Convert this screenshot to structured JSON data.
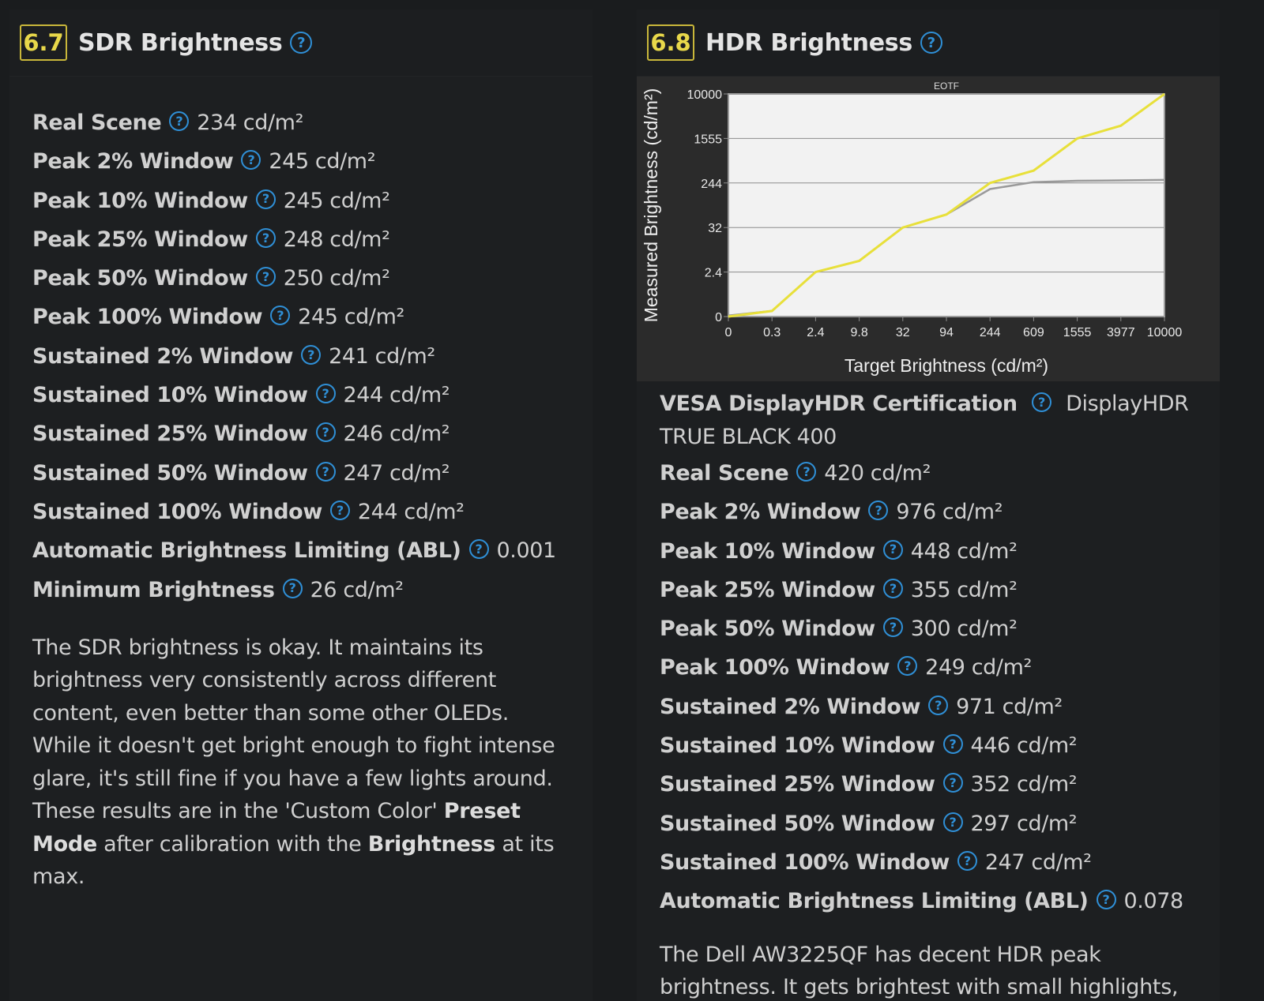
{
  "sdr": {
    "score": "6.7",
    "title": "SDR Brightness",
    "rows": [
      {
        "label": "Real Scene",
        "value": "234 cd/m²"
      },
      {
        "label": "Peak 2% Window",
        "value": "245 cd/m²"
      },
      {
        "label": "Peak 10% Window",
        "value": "245 cd/m²"
      },
      {
        "label": "Peak 25% Window",
        "value": "248 cd/m²"
      },
      {
        "label": "Peak 50% Window",
        "value": "250 cd/m²"
      },
      {
        "label": "Peak 100% Window",
        "value": "245 cd/m²"
      },
      {
        "label": "Sustained 2% Window",
        "value": "241 cd/m²"
      },
      {
        "label": "Sustained 10% Window",
        "value": "244 cd/m²"
      },
      {
        "label": "Sustained 25% Window",
        "value": "246 cd/m²"
      },
      {
        "label": "Sustained 50% Window",
        "value": "247 cd/m²"
      },
      {
        "label": "Sustained 100% Window",
        "value": "244 cd/m²"
      },
      {
        "label": "Automatic Brightness Limiting (ABL)",
        "value": "0.001"
      },
      {
        "label": "Minimum Brightness",
        "value": "26 cd/m²"
      }
    ],
    "paragraph": {
      "t1": "The SDR brightness is okay. It maintains its brightness very consistently across different content, even better than some other OLEDs. While it doesn't get bright enough to fight intense glare, it's still fine if you have a few lights around. These results are in the 'Custom Color' ",
      "b1": "Preset Mode",
      "t2": " after calibration with the ",
      "b2": "Brightness",
      "t3": " at its max."
    }
  },
  "hdr": {
    "score": "6.8",
    "title": "HDR Brightness",
    "vesa": {
      "label": "VESA DisplayHDR Certification",
      "value": "DisplayHDR TRUE BLACK 400"
    },
    "rows": [
      {
        "label": "Real Scene",
        "value": "420 cd/m²"
      },
      {
        "label": "Peak 2% Window",
        "value": "976 cd/m²"
      },
      {
        "label": "Peak 10% Window",
        "value": "448 cd/m²"
      },
      {
        "label": "Peak 25% Window",
        "value": "355 cd/m²"
      },
      {
        "label": "Peak 50% Window",
        "value": "300 cd/m²"
      },
      {
        "label": "Peak 100% Window",
        "value": "249 cd/m²"
      },
      {
        "label": "Sustained 2% Window",
        "value": "971 cd/m²"
      },
      {
        "label": "Sustained 10% Window",
        "value": "446 cd/m²"
      },
      {
        "label": "Sustained 25% Window",
        "value": "352 cd/m²"
      },
      {
        "label": "Sustained 50% Window",
        "value": "297 cd/m²"
      },
      {
        "label": "Sustained 100% Window",
        "value": "247 cd/m²"
      },
      {
        "label": "Automatic Brightness Limiting (ABL)",
        "value": "0.078"
      }
    ],
    "paragraph": "The Dell AW3225QF has decent HDR peak brightness. It gets brightest with small highlights, meaning they"
  },
  "help_glyph": "?",
  "chart_data": {
    "type": "line",
    "title": "EOTF",
    "xlabel": "Target Brightness (cd/m²)",
    "ylabel": "Measured Brightness (cd/m²)",
    "x_ticks": [
      "0",
      "0.3",
      "2.4",
      "9.8",
      "32",
      "94",
      "244",
      "609",
      "1555",
      "3977",
      "10000"
    ],
    "y_ticks": [
      "0",
      "2.4",
      "32",
      "244",
      "1555",
      "10000"
    ],
    "grid": true,
    "series": [
      {
        "color": "#e8e03a",
        "points": [
          [
            0,
            0
          ],
          [
            0.3,
            0.3
          ],
          [
            2.4,
            2.4
          ],
          [
            9.8,
            9.8
          ],
          [
            32,
            32
          ],
          [
            94,
            94
          ],
          [
            244,
            244
          ],
          [
            609,
            609
          ],
          [
            1555,
            1555
          ],
          [
            3977,
            3977
          ],
          [
            10000,
            10000
          ]
        ]
      },
      {
        "color": "#9a9a9a",
        "points": [
          [
            0,
            0.05
          ],
          [
            0.3,
            0.3
          ],
          [
            2.4,
            2.4
          ],
          [
            9.8,
            9.8
          ],
          [
            32,
            32
          ],
          [
            94,
            94
          ],
          [
            244,
            215
          ],
          [
            609,
            270
          ],
          [
            1555,
            310
          ],
          [
            3977,
            320
          ],
          [
            10000,
            335
          ]
        ]
      }
    ]
  }
}
